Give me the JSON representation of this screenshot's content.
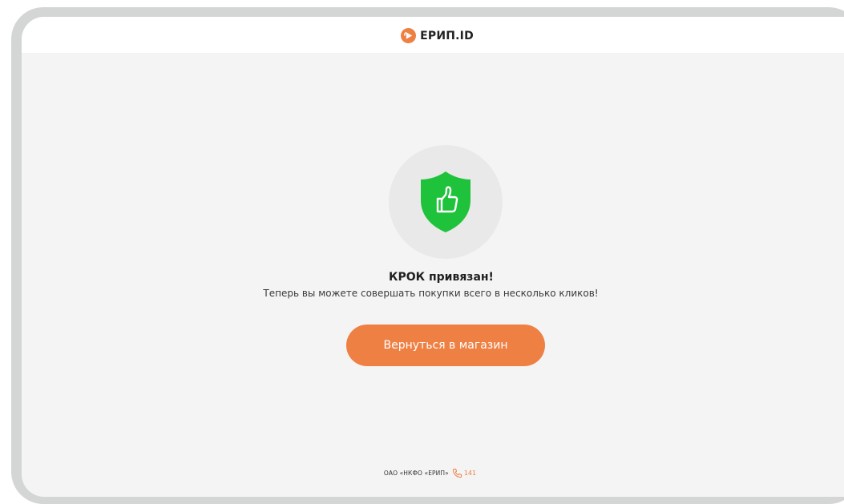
{
  "header": {
    "logo_text": "ЕРИП.ID"
  },
  "status": {
    "icon": "shield-thumbs-up-icon",
    "title": "КРОК привязан!",
    "message": "Теперь вы можете совершать покупки всего в несколько кликов!"
  },
  "actions": {
    "return_label": "Вернуться в магазин"
  },
  "footer": {
    "company": "ОАО «НКФО «ЕРИП»",
    "phone": "141"
  },
  "colors": {
    "accent": "#ef8044",
    "success": "#1fc33b",
    "background": "#f4f4f4",
    "frame": "#d4d6d5"
  }
}
